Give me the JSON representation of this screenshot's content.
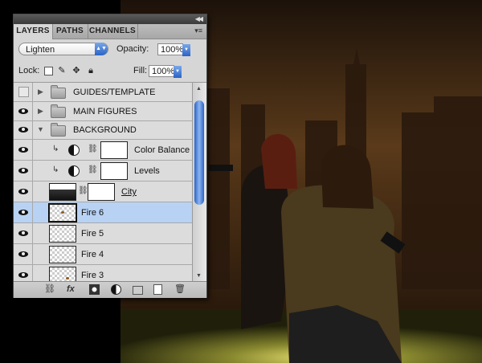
{
  "panel": {
    "tabs": [
      "LAYERS",
      "PATHS",
      "CHANNELS"
    ],
    "blend_mode": "Lighten",
    "opacity_label": "Opacity:",
    "opacity_value": "100%",
    "lock_label": "Lock:",
    "fill_label": "Fill:",
    "fill_value": "100%"
  },
  "layers": [
    {
      "name": "GUIDES/TEMPLATE",
      "type": "group",
      "visible": false,
      "expanded": false
    },
    {
      "name": "MAIN FIGURES",
      "type": "group",
      "visible": true,
      "expanded": false
    },
    {
      "name": "BACKGROUND",
      "type": "group",
      "visible": true,
      "expanded": true
    },
    {
      "name": "Color Balance",
      "type": "adjustment",
      "visible": true
    },
    {
      "name": "Levels",
      "type": "adjustment",
      "visible": true
    },
    {
      "name": "City",
      "type": "masked-layer",
      "visible": true
    },
    {
      "name": "Fire 6",
      "type": "layer",
      "visible": true,
      "selected": true
    },
    {
      "name": "Fire 5",
      "type": "layer",
      "visible": true
    },
    {
      "name": "Fire 4",
      "type": "layer",
      "visible": true
    },
    {
      "name": "Fire 3",
      "type": "layer",
      "visible": true
    }
  ],
  "footer_icons": [
    "link-layers-icon",
    "fx-icon",
    "add-mask-icon",
    "new-adjustment-icon",
    "new-group-icon",
    "new-layer-icon",
    "trash-icon"
  ],
  "colors": {
    "selection": "#b8d2f4",
    "accent": "#2a63c6"
  }
}
